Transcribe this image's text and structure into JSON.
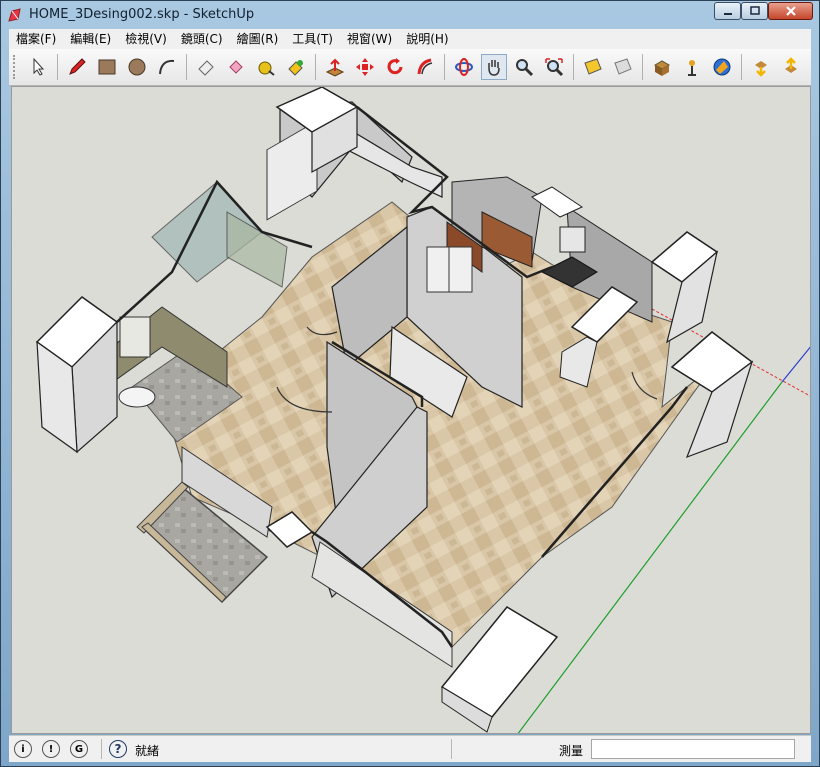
{
  "window": {
    "title": "HOME_3Desing002.skp - SketchUp"
  },
  "menu": [
    "檔案(F)",
    "編輯(E)",
    "檢視(V)",
    "鏡頭(C)",
    "繪圖(R)",
    "工具(T)",
    "視窗(W)",
    "說明(H)"
  ],
  "toolbar": {
    "tools": [
      "select-icon",
      "pencil-icon",
      "rectangle-icon",
      "circle-icon",
      "arc-icon",
      "eraser-icon",
      "paint-bucket-icon",
      "tape-measure-icon",
      "paint-icon",
      "push-pull-icon",
      "move-icon",
      "rotate-icon",
      "follow-me-icon",
      "orbit-icon",
      "pan-icon",
      "zoom-icon",
      "zoom-extents-icon",
      "section-icon",
      "section-fill-icon",
      "component-icon",
      "position-camera-icon",
      "google-earth-icon",
      "get-models-icon",
      "share-model-icon"
    ],
    "active_tool": "pan-icon"
  },
  "status": {
    "text": "就緒",
    "measure_label": "測量",
    "measure_value": ""
  },
  "colors": {
    "axis_red": "#d44",
    "axis_green": "#2a2",
    "axis_blue": "#33c"
  }
}
